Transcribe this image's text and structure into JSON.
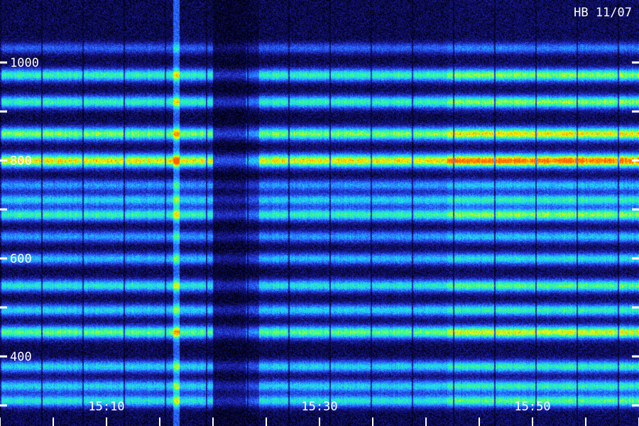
{
  "chart_data": {
    "type": "heatmap",
    "title": "",
    "station_label": "HB 11/07",
    "xlabel": "",
    "ylabel": "",
    "x_range": [
      "15:05",
      "15:64"
    ],
    "x_min_minutes": 0,
    "x_max_minutes": 60,
    "x_origin_label": "15:05",
    "x_ticks_labeled": [
      {
        "label": "15:10",
        "minute": 10
      },
      {
        "label": "15:30",
        "minute": 30
      },
      {
        "label": "15:50",
        "minute": 50
      }
    ],
    "x_minor_tick_minutes": [
      0,
      5,
      10,
      15,
      20,
      25,
      30,
      35,
      40,
      45,
      50,
      55,
      60
    ],
    "y_ticks": [
      {
        "value": 1000,
        "label": "1000"
      },
      {
        "value": 900,
        "label": ""
      },
      {
        "value": 800,
        "label": "800"
      },
      {
        "value": 700,
        "label": ""
      },
      {
        "value": 600,
        "label": "600"
      },
      {
        "value": 500,
        "label": ""
      },
      {
        "value": 400,
        "label": "400"
      },
      {
        "value": 300,
        "label": ""
      }
    ],
    "ylim": [
      300,
      1060
    ],
    "bands": [
      {
        "freq": 1030,
        "intensity": 0.25
      },
      {
        "freq": 975,
        "intensity": 0.55
      },
      {
        "freq": 920,
        "intensity": 0.55
      },
      {
        "freq": 855,
        "intensity": 0.65
      },
      {
        "freq": 800,
        "intensity": 0.78
      },
      {
        "freq": 750,
        "intensity": 0.35
      },
      {
        "freq": 720,
        "intensity": 0.45
      },
      {
        "freq": 690,
        "intensity": 0.55
      },
      {
        "freq": 645,
        "intensity": 0.35
      },
      {
        "freq": 600,
        "intensity": 0.4
      },
      {
        "freq": 545,
        "intensity": 0.5
      },
      {
        "freq": 495,
        "intensity": 0.45
      },
      {
        "freq": 450,
        "intensity": 0.62
      },
      {
        "freq": 380,
        "intensity": 0.45
      },
      {
        "freq": 340,
        "intensity": 0.45
      },
      {
        "freq": 310,
        "intensity": 0.5
      }
    ],
    "colormap": [
      "#000010",
      "#1a1aa0",
      "#2a60ff",
      "#20d0ff",
      "#30ff90",
      "#ffff00",
      "#ff6000"
    ]
  }
}
